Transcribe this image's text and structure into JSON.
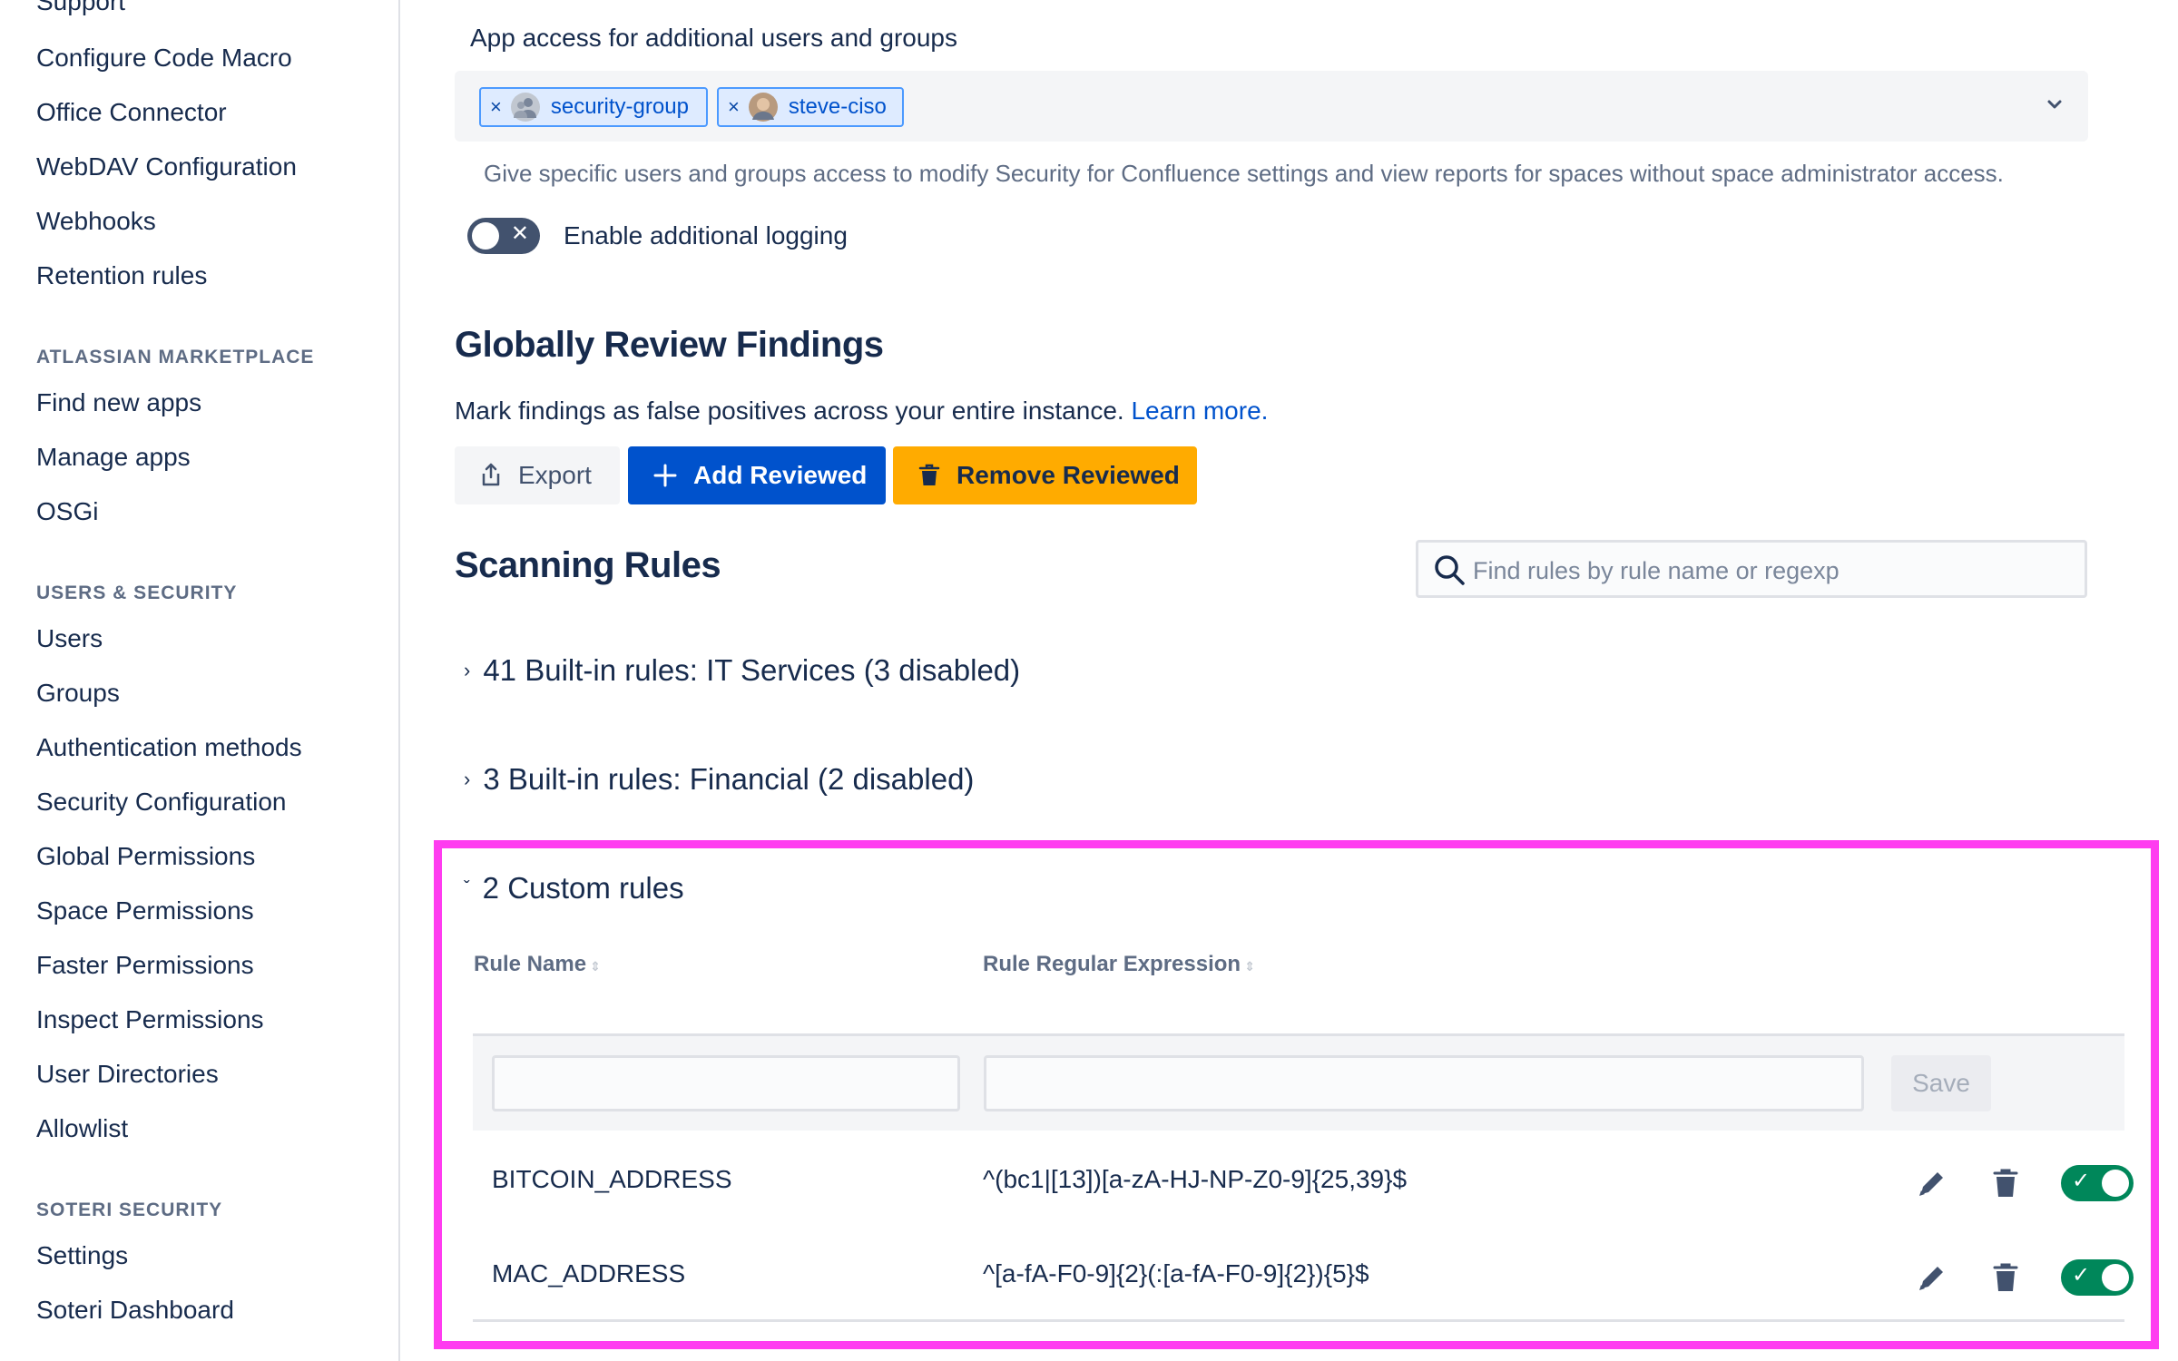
{
  "sidebar": {
    "items_top": [
      {
        "label": "Support"
      },
      {
        "label": "Configure Code Macro"
      },
      {
        "label": "Office Connector"
      },
      {
        "label": "WebDAV Configuration"
      },
      {
        "label": "Webhooks"
      },
      {
        "label": "Retention rules"
      }
    ],
    "sections": [
      {
        "heading": "ATLASSIAN MARKETPLACE",
        "items": [
          "Find new apps",
          "Manage apps",
          "OSGi"
        ]
      },
      {
        "heading": "USERS & SECURITY",
        "items": [
          "Users",
          "Groups",
          "Authentication methods",
          "Security Configuration",
          "Global Permissions",
          "Space Permissions",
          "Faster Permissions",
          "Inspect Permissions",
          "User Directories",
          "Allowlist"
        ]
      },
      {
        "heading": "SOTERI SECURITY",
        "items": [
          "Settings",
          "Soteri Dashboard"
        ]
      }
    ]
  },
  "access": {
    "label": "App access for additional users and groups",
    "chips": [
      {
        "remove": "×",
        "label": "security-group",
        "icon": "group-avatar-icon"
      },
      {
        "remove": "×",
        "label": "steve-ciso",
        "icon": "user-avatar-icon"
      }
    ],
    "helper": "Give specific users and groups access to modify Security for Confluence settings and view reports for spaces without space administrator access."
  },
  "logging": {
    "label": "Enable additional logging",
    "enabled": false
  },
  "review": {
    "title": "Globally Review Findings",
    "description": "Mark findings as false positives across your entire instance.",
    "learn_more": "Learn more.",
    "buttons": {
      "export": "Export",
      "add": "Add Reviewed",
      "remove": "Remove Reviewed"
    }
  },
  "rules": {
    "title": "Scanning Rules",
    "search_placeholder": "Find rules by rule name or regexp",
    "groups": [
      {
        "label": "41 Built-in rules: IT Services (3 disabled)",
        "expanded": false
      },
      {
        "label": "3 Built-in rules: Financial (2 disabled)",
        "expanded": false
      },
      {
        "label": "2 Custom rules",
        "expanded": true
      }
    ],
    "columns": {
      "name": "Rule Name",
      "regex": "Rule Regular Expression"
    },
    "save_label": "Save",
    "custom": [
      {
        "name": "BITCOIN_ADDRESS",
        "regex": "^(bc1|[13])[a-zA-HJ-NP-Z0-9]{25,39}$",
        "enabled": true
      },
      {
        "name": "MAC_ADDRESS",
        "regex": "^[a-fA-F0-9]{2}(:[a-fA-F0-9]{2}){5}$",
        "enabled": true
      }
    ]
  },
  "colors": {
    "accent": "#0052cc",
    "warning": "#ffab00",
    "highlight": "#ff3cf0",
    "toggle_on": "#00875a"
  }
}
